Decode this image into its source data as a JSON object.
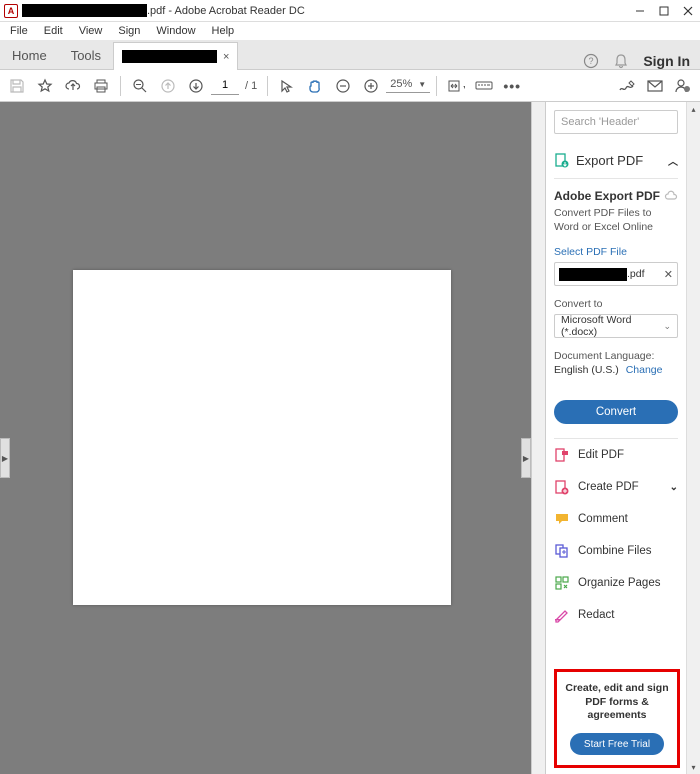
{
  "titlebar": {
    "suffix": ".pdf - Adobe Acrobat Reader DC"
  },
  "menubar": [
    "File",
    "Edit",
    "View",
    "Sign",
    "Window",
    "Help"
  ],
  "tabs": {
    "home": "Home",
    "tools": "Tools",
    "file_close": "×",
    "sign_in": "Sign In"
  },
  "toolbar": {
    "page_current": "1",
    "page_total": "/ 1",
    "zoom": "25%"
  },
  "right": {
    "search_placeholder": "Search 'Header'",
    "export_header": "Export PDF",
    "export_title": "Adobe Export PDF",
    "export_desc": "Convert PDF Files to Word or Excel Online",
    "select_label": "Select PDF File",
    "file_ext": ".pdf",
    "convert_label": "Convert to",
    "convert_value": "Microsoft Word (*.docx)",
    "lang_label": "Document Language:",
    "lang_value": "English (U.S.)",
    "lang_change": "Change",
    "convert_btn": "Convert",
    "tools": {
      "edit": "Edit PDF",
      "create": "Create PDF",
      "comment": "Comment",
      "combine": "Combine Files",
      "organize": "Organize Pages",
      "redact": "Redact"
    },
    "promo_text": "Create, edit and sign PDF forms & agreements",
    "promo_btn": "Start Free Trial"
  }
}
